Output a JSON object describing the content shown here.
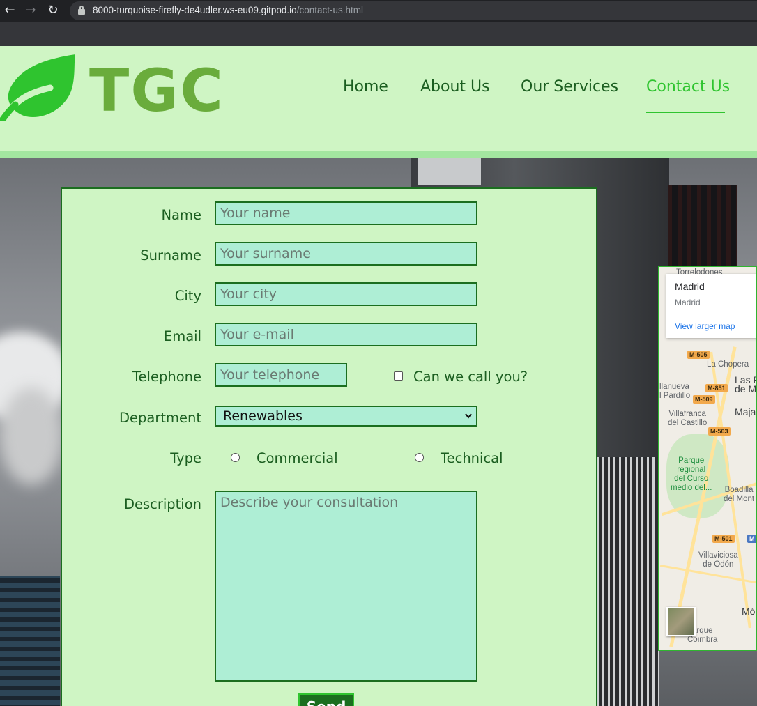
{
  "browser": {
    "url_host": "8000-turquoise-firefly-de4udler.ws-eu09.gitpod.io",
    "url_path": "/contact-us.html",
    "back_icon": "arrow-left-icon",
    "forward_icon": "arrow-right-icon",
    "reload_icon": "reload-icon"
  },
  "header": {
    "logo_text": "TGC",
    "nav": [
      {
        "label": "Home"
      },
      {
        "label": "About Us"
      },
      {
        "label": "Our Services"
      },
      {
        "label": "Contact Us",
        "active": true
      }
    ]
  },
  "form": {
    "name": {
      "label": "Name",
      "placeholder": "Your name"
    },
    "surname": {
      "label": "Surname",
      "placeholder": "Your surname"
    },
    "city": {
      "label": "City",
      "placeholder": "Your city"
    },
    "email": {
      "label": "Email",
      "placeholder": "Your e-mail"
    },
    "telephone": {
      "label": "Telephone",
      "placeholder": "Your telephone"
    },
    "call_checkbox": {
      "label": "Can we call you?"
    },
    "department": {
      "label": "Department",
      "selected": "Renewables"
    },
    "type": {
      "label": "Type",
      "options": [
        "Commercial",
        "Technical"
      ]
    },
    "description": {
      "label": "Description",
      "placeholder": "Describe your consultation"
    },
    "send_label": "Send"
  },
  "map": {
    "place_title": "Madrid",
    "place_subtitle": "Madrid",
    "view_larger": "View larger map",
    "labels": {
      "torrelodones": "Torrelodones",
      "la_chopera": "La Chopera",
      "las_rozas": "Las R\nde M",
      "villanueva": "llanueva\nl Pardillo",
      "majadahonda": "Majad",
      "villafranca": "Villafranca\ndel Castillo",
      "parque": "Parque\nregional\ndel Curso\nmedio del...",
      "boadilla": "Boadilla\ndel Mont",
      "villaviciosa": "Villaviciosa\nde Odón",
      "mostoles": "Mó",
      "parque_coimbra": "arque\nCoimbra"
    },
    "shields": [
      "M-505",
      "M-851",
      "M-509",
      "M-503",
      "M-501",
      "M"
    ]
  },
  "colors": {
    "header_bg": "#cff5c4",
    "nav_text": "#1b5e20",
    "nav_active": "#2fc42f",
    "field_bg": "#aeeed5",
    "logo_green": "#6aac3c"
  }
}
